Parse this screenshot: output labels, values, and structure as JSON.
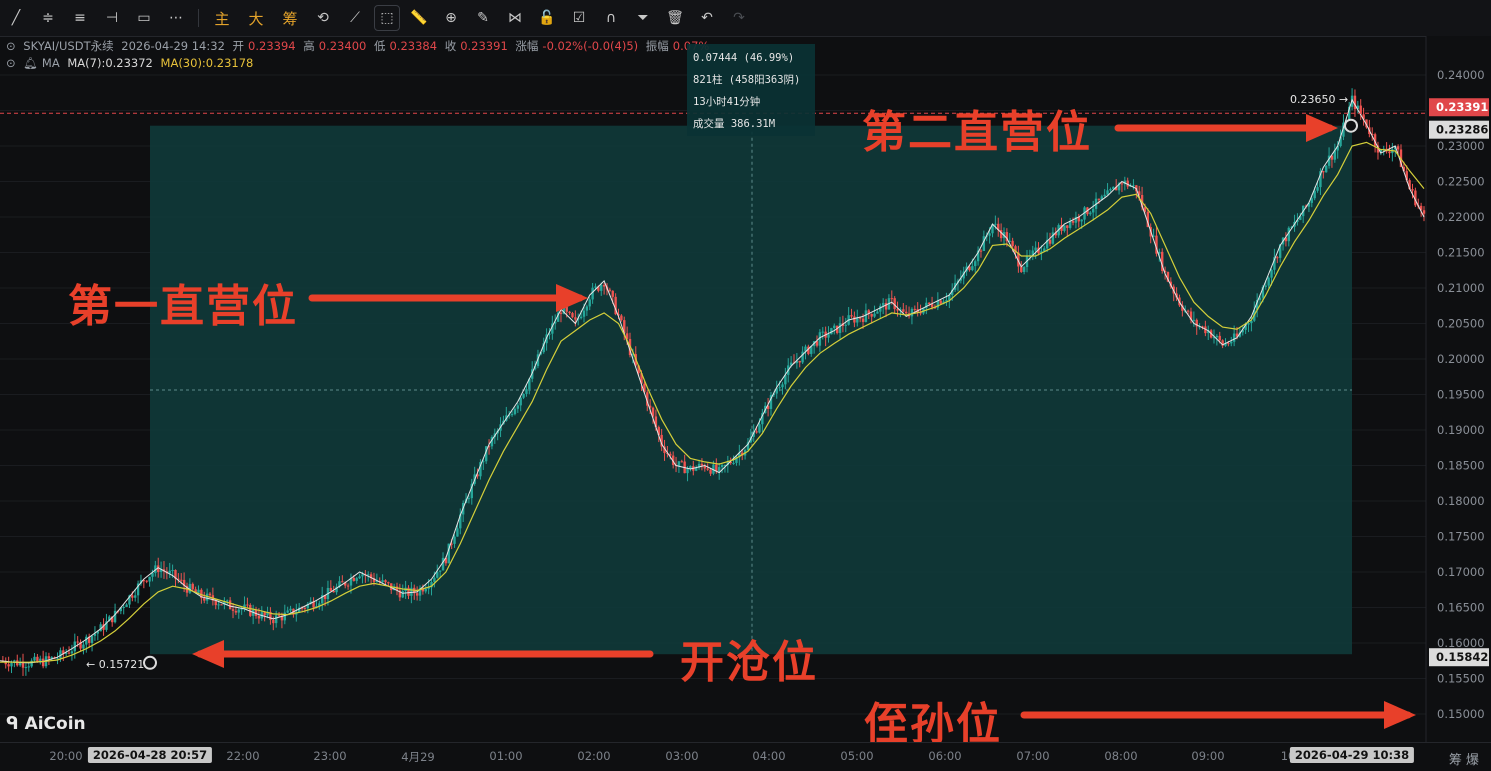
{
  "toolbar": {
    "icons": [
      "trend-line",
      "parallel-lines",
      "horizontal-lines",
      "horizontal-ray",
      "rectangle",
      "more"
    ],
    "text_buttons": [
      "主",
      "大",
      "筹"
    ],
    "tools": [
      "replay",
      "ruler",
      "zoom",
      "brush",
      "pattern",
      "lock",
      "snapshot",
      "magnet",
      "filter",
      "delete",
      "undo",
      "redo"
    ]
  },
  "info": {
    "symbol": "SKYAI/USDT永续",
    "datetime": "2026-04-29 14:32",
    "open_label": "开",
    "open": "0.23394",
    "high_label": "高",
    "high": "0.23400",
    "low_label": "低",
    "low": "0.23384",
    "close_label": "收",
    "close": "0.23391",
    "change_label": "涨幅",
    "change": "-0.02%(-0.0(4)5)",
    "amp_label": "振幅",
    "amp": "0.07%",
    "ma_label": "MA",
    "ma7": "MA(7):0.23372",
    "ma30": "MA(30):0.23178"
  },
  "tooltip": {
    "line1": "0.07444 (46.99%)",
    "line2": "821柱 (458阳363阴)",
    "line3": "13小时41分钟",
    "line4": "成交量 386.31M"
  },
  "annotations": {
    "tp1": "第一直营位",
    "tp2": "第二直营位",
    "entry": "开沧位",
    "stop": "侄孙位"
  },
  "logo": "AiCoin",
  "corner": "筹 爆",
  "colors": {
    "up": "#26a69a",
    "down": "#ef5350",
    "ma7": "#e6e6e6",
    "ma30": "#d4cf3a",
    "box": "#0f3a3a",
    "arrow": "#e8402a"
  },
  "chart_data": {
    "type": "candlestick",
    "yticks": [
      "0.24000",
      "0.23500",
      "0.23000",
      "0.22500",
      "0.22000",
      "0.21500",
      "0.21000",
      "0.20500",
      "0.20000",
      "0.19500",
      "0.19000",
      "0.18500",
      "0.18000",
      "0.17500",
      "0.17000",
      "0.16500",
      "0.16000",
      "0.15500",
      "0.15000"
    ],
    "ylim": [
      0.1445,
      0.2422
    ],
    "xticks": [
      "20:00",
      "2026-04-28 20:57",
      "22:00",
      "23:00",
      "4月29",
      "01:00",
      "02:00",
      "03:00",
      "04:00",
      "05:00",
      "06:00",
      "07:00",
      "08:00",
      "09:00",
      "10:",
      "2026-04-29 10:38"
    ],
    "close_series": [
      0.1575,
      0.1573,
      0.1572,
      0.1574,
      0.158,
      0.1592,
      0.1605,
      0.162,
      0.164,
      0.1665,
      0.169,
      0.1706,
      0.1695,
      0.1678,
      0.1665,
      0.166,
      0.1652,
      0.1648,
      0.164,
      0.1634,
      0.164,
      0.165,
      0.166,
      0.1672,
      0.1685,
      0.17,
      0.169,
      0.168,
      0.167,
      0.1672,
      0.169,
      0.172,
      0.178,
      0.183,
      0.188,
      0.191,
      0.194,
      0.198,
      0.203,
      0.207,
      0.205,
      0.209,
      0.211,
      0.206,
      0.2,
      0.194,
      0.188,
      0.185,
      0.1845,
      0.185,
      0.184,
      0.186,
      0.188,
      0.192,
      0.196,
      0.199,
      0.201,
      0.203,
      0.204,
      0.2055,
      0.206,
      0.207,
      0.208,
      0.206,
      0.207,
      0.208,
      0.209,
      0.212,
      0.215,
      0.219,
      0.217,
      0.213,
      0.215,
      0.217,
      0.219,
      0.22,
      0.2215,
      0.223,
      0.225,
      0.224,
      0.218,
      0.212,
      0.208,
      0.205,
      0.204,
      0.202,
      0.203,
      0.206,
      0.211,
      0.216,
      0.219,
      0.222,
      0.227,
      0.23,
      0.2365,
      0.233,
      0.229,
      0.23,
      0.224,
      0.22
    ],
    "ma30_series": [
      0.1573,
      0.1573,
      0.1573,
      0.1574,
      0.1576,
      0.1583,
      0.1592,
      0.1603,
      0.1617,
      0.1635,
      0.1655,
      0.1672,
      0.168,
      0.1676,
      0.1668,
      0.1662,
      0.1656,
      0.165,
      0.1646,
      0.1641,
      0.164,
      0.1644,
      0.165,
      0.1659,
      0.167,
      0.168,
      0.1684,
      0.168,
      0.1676,
      0.1674,
      0.168,
      0.17,
      0.174,
      0.1785,
      0.183,
      0.187,
      0.1905,
      0.194,
      0.1985,
      0.2025,
      0.204,
      0.2055,
      0.2065,
      0.205,
      0.201,
      0.196,
      0.1915,
      0.188,
      0.186,
      0.1855,
      0.1852,
      0.1858,
      0.187,
      0.1895,
      0.193,
      0.1962,
      0.1988,
      0.2008,
      0.2022,
      0.2035,
      0.2045,
      0.2055,
      0.2065,
      0.2062,
      0.2066,
      0.2073,
      0.2082,
      0.21,
      0.2125,
      0.216,
      0.2162,
      0.2145,
      0.2145,
      0.2155,
      0.217,
      0.2183,
      0.2196,
      0.221,
      0.2228,
      0.2232,
      0.2205,
      0.216,
      0.2115,
      0.208,
      0.206,
      0.2045,
      0.2042,
      0.2055,
      0.209,
      0.213,
      0.2165,
      0.2195,
      0.223,
      0.226,
      0.23,
      0.2305,
      0.2295,
      0.2293,
      0.2265,
      0.224
    ],
    "labels": {
      "high_marker": "0.23650",
      "entry_marker": "0.15721",
      "price_line1": "0.23286",
      "price_line2": "0.23391",
      "box_price": "0.15842"
    },
    "range_box": {
      "from_price": 0.15842,
      "to_price": 0.23286
    }
  }
}
